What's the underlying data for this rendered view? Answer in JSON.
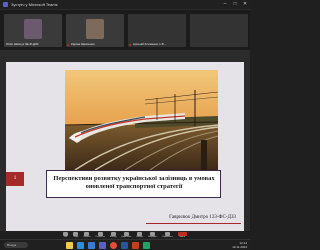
{
  "window": {
    "title": "Зустріч у Microsoft Teams"
  },
  "participants": [
    {
      "name": "Юлія Шевчук ЗЕ-Ф-ДЗ3",
      "color": "#6b5a6e"
    },
    {
      "name": "Каріна Шевченко",
      "color": "#7d6a5d"
    },
    {
      "name": "Арсеній Клименко 1 Ф...",
      "color": ""
    },
    {
      "name": "",
      "color": ""
    }
  ],
  "slide": {
    "number": "1",
    "title": "Перспективи розвитку української залізниць в умовах оновленої транспортної стратегії",
    "author": "Гаврилюк Дмитро 133-ФС-ДЗ3",
    "accent": "#a52a2a"
  },
  "meeting_bar": {
    "items": [
      {
        "label": "Чат",
        "icon": "chat-icon"
      },
      {
        "label": "Люди",
        "icon": "people-icon"
      },
      {
        "label": "Підняти",
        "icon": "raise-hand-icon"
      },
      {
        "label": "Реагувати",
        "icon": "react-icon"
      },
      {
        "label": "Вигляд",
        "icon": "view-icon"
      },
      {
        "label": "Додатково",
        "icon": "more-icon"
      },
      {
        "label": "Камера",
        "icon": "camera-icon"
      },
      {
        "label": "Мікрофон",
        "icon": "mic-icon"
      },
      {
        "label": "Поділитися",
        "icon": "share-icon"
      }
    ],
    "leave_label": "Вийти"
  },
  "taskbar": {
    "search_placeholder": "Пошук",
    "time": "12:14",
    "date": "12.11.2023",
    "apps": [
      {
        "icon": "file-explorer-icon",
        "color": "#f2c94c"
      },
      {
        "icon": "edge-icon",
        "color": "#2a8fd6"
      },
      {
        "icon": "store-icon",
        "color": "#3a7bd5"
      },
      {
        "icon": "teams-icon",
        "color": "#5b5fc7"
      },
      {
        "icon": "chrome-icon",
        "color": "#e9483b"
      },
      {
        "icon": "word-icon",
        "color": "#2b579a"
      },
      {
        "icon": "powerpoint-icon",
        "color": "#c43e1c"
      },
      {
        "icon": "excel-icon",
        "color": "#21a366"
      }
    ]
  }
}
